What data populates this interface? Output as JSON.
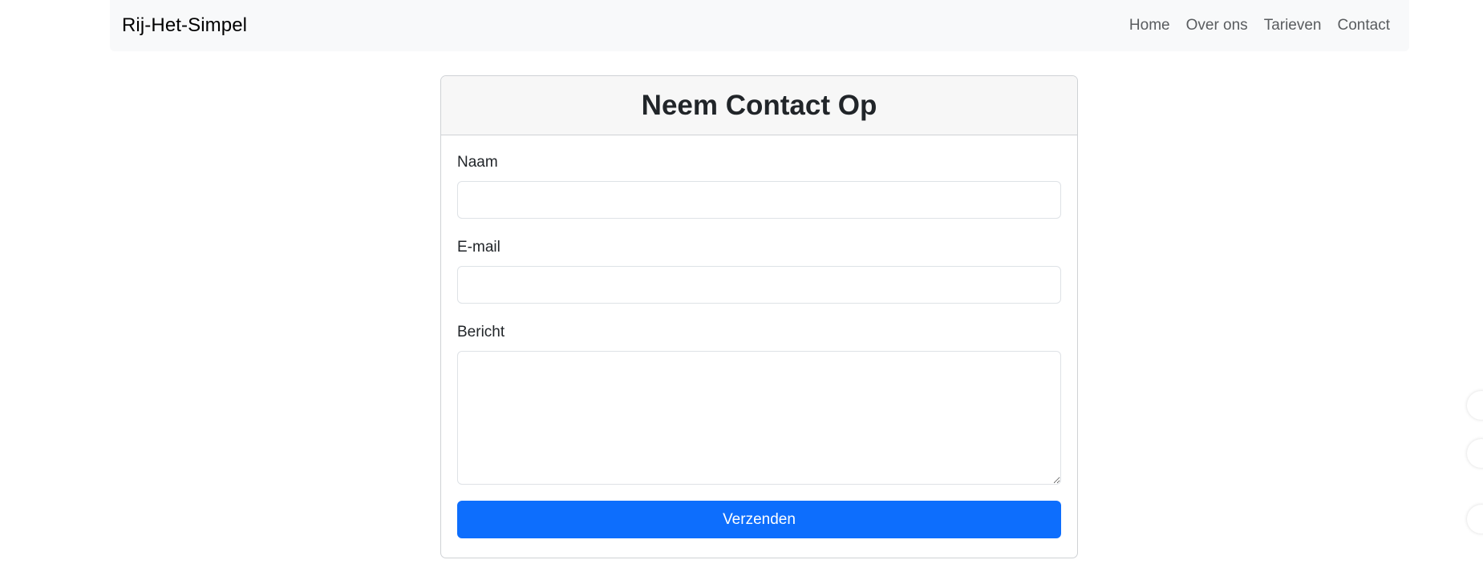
{
  "navbar": {
    "brand": "Rij-Het-Simpel",
    "links": [
      {
        "label": "Home"
      },
      {
        "label": "Over ons"
      },
      {
        "label": "Tarieven"
      },
      {
        "label": "Contact"
      }
    ]
  },
  "contact_form": {
    "title": "Neem Contact Op",
    "fields": {
      "name": {
        "label": "Naam",
        "value": ""
      },
      "email": {
        "label": "E-mail",
        "value": ""
      },
      "message": {
        "label": "Bericht",
        "value": ""
      }
    },
    "submit_label": "Verzenden"
  },
  "colors": {
    "primary": "#0d6efd",
    "navbar_bg": "#f8f9fa",
    "card_header_bg": "#f7f7f7"
  }
}
